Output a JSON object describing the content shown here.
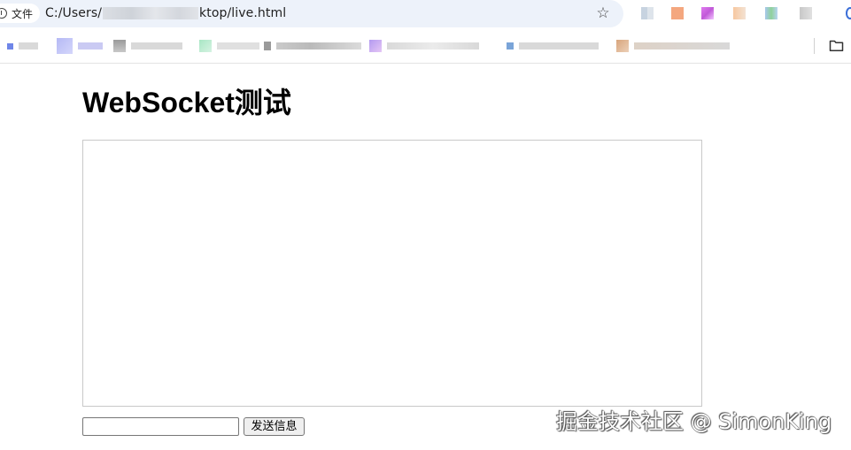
{
  "browser": {
    "site_label": "文件",
    "url_start": "C:/Users/",
    "url_end": "ktop/live.html",
    "icons": {
      "site_info": "info-circle-icon",
      "bookmark": "star-icon",
      "bookmarks_folder": "folder-icon"
    }
  },
  "page": {
    "title": "WebSocket测试",
    "message_input_value": "",
    "send_button_label": "发送信息"
  },
  "watermark": {
    "text": "掘金技术社区 @ SimonKing"
  },
  "colors": {
    "omnibox_bg": "#edf2fa",
    "box_border": "#c9c9c9",
    "button_bg": "#efefef"
  }
}
